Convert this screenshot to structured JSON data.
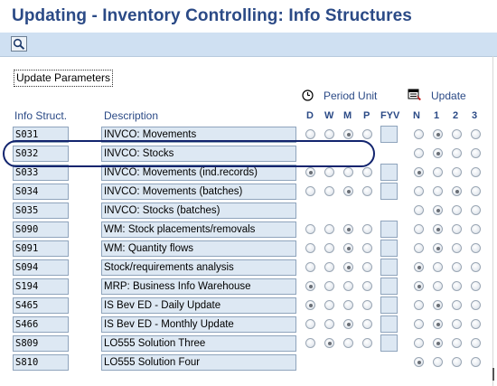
{
  "title": "Updating - Inventory Controlling: Info Structures",
  "toolbar": {
    "buttons": [
      {
        "icon": "find-icon"
      }
    ]
  },
  "group_label": "Update Parameters",
  "headers": {
    "info_struct": "Info Struct.",
    "description": "Description",
    "period_unit": "Period Unit",
    "update": "Update",
    "period_cols": [
      "D",
      "W",
      "M",
      "P",
      "FYV"
    ],
    "update_cols": [
      "N",
      "1",
      "2",
      "3"
    ]
  },
  "rows": [
    {
      "code": "S031",
      "desc": "INVCO: Movements",
      "period": [
        "",
        "",
        "M",
        ""
      ],
      "fyv": true,
      "update": "1"
    },
    {
      "code": "S032",
      "desc": "INVCO: Stocks",
      "period": null,
      "fyv": false,
      "update": "1"
    },
    {
      "code": "S033",
      "desc": "INVCO: Movements (ind.records)",
      "period": [
        "D",
        "",
        "",
        ""
      ],
      "fyv": true,
      "update": "N"
    },
    {
      "code": "S034",
      "desc": "INVCO: Movements (batches)",
      "period": [
        "",
        "",
        "M",
        ""
      ],
      "fyv": true,
      "update": "2"
    },
    {
      "code": "S035",
      "desc": "INVCO: Stocks (batches)",
      "period": null,
      "fyv": false,
      "update": "1"
    },
    {
      "code": "S090",
      "desc": "WM: Stock placements/removals",
      "period": [
        "",
        "",
        "M",
        ""
      ],
      "fyv": true,
      "update": "1"
    },
    {
      "code": "S091",
      "desc": "WM: Quantity flows",
      "period": [
        "",
        "",
        "M",
        ""
      ],
      "fyv": true,
      "update": "1"
    },
    {
      "code": "S094",
      "desc": "Stock/requirements analysis",
      "period": [
        "",
        "",
        "M",
        ""
      ],
      "fyv": true,
      "update": "N"
    },
    {
      "code": "S194",
      "desc": "MRP: Business Info Warehouse",
      "period": [
        "D",
        "",
        "",
        ""
      ],
      "fyv": true,
      "update": "N"
    },
    {
      "code": "S465",
      "desc": "IS Bev ED - Daily Update",
      "period": [
        "D",
        "",
        "",
        ""
      ],
      "fyv": true,
      "update": "1"
    },
    {
      "code": "S466",
      "desc": "IS Bev ED - Monthly Update",
      "period": [
        "",
        "",
        "M",
        ""
      ],
      "fyv": true,
      "update": "1"
    },
    {
      "code": "S809",
      "desc": "LO555 Solution Three",
      "period": [
        "",
        "W",
        "",
        ""
      ],
      "fyv": true,
      "update": "1"
    },
    {
      "code": "S810",
      "desc": "LO555 Solution Four",
      "period": null,
      "fyv": false,
      "update": "N"
    }
  ],
  "highlighted_row": "S032"
}
